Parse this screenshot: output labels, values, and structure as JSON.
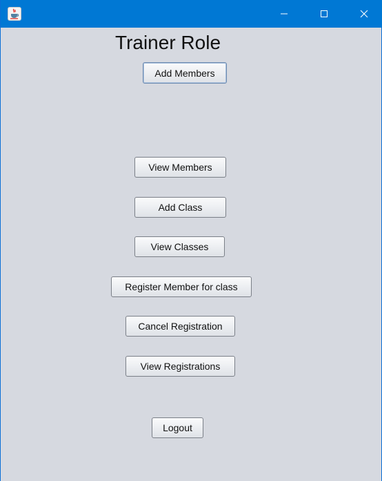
{
  "window": {
    "icon": "java-cup-icon",
    "controls": {
      "minimize": "minimize-icon",
      "maximize": "maximize-icon",
      "close": "close-icon"
    },
    "colors": {
      "titlebar": "#0078d4",
      "background": "#d6d9e0"
    }
  },
  "main": {
    "heading": "Trainer Role",
    "buttons": {
      "add_members": "Add Members",
      "view_members": "View Members",
      "add_class": "Add Class",
      "view_classes": "View Classes",
      "register_member": "Register Member for class",
      "cancel_registration": "Cancel Registration",
      "view_registrations": "View Registrations",
      "logout": "Logout"
    }
  }
}
